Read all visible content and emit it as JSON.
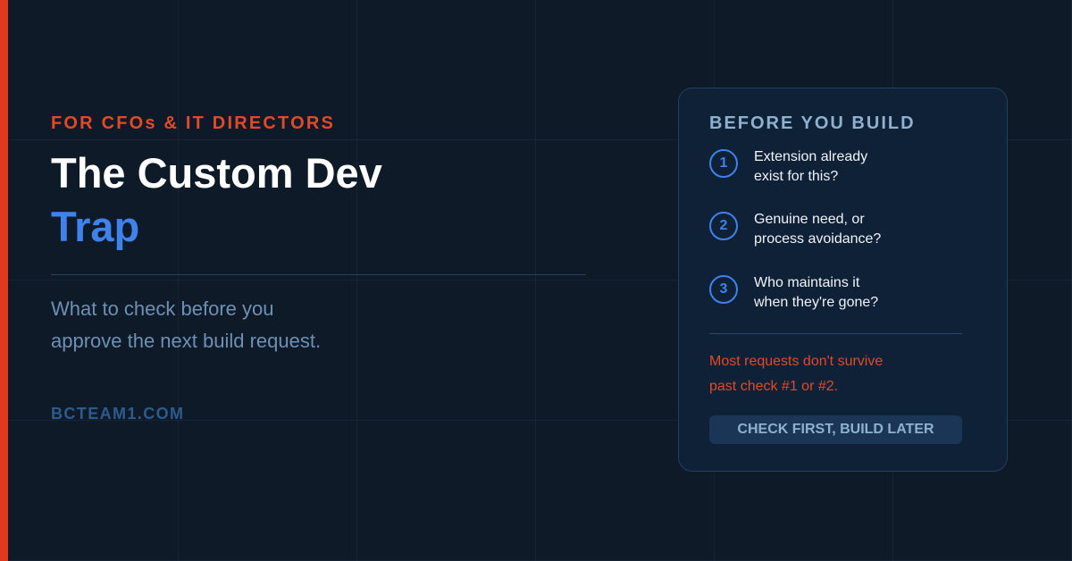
{
  "hero": {
    "eyebrow": "FOR CFOs & IT DIRECTORS",
    "title_line1": "The Custom Dev",
    "title_line2": "Trap",
    "subtitle_line1": "What to check before you",
    "subtitle_line2": "approve the next build request.",
    "site": "BCTEAM1.COM"
  },
  "card": {
    "title": "BEFORE YOU BUILD",
    "steps": [
      {
        "number": "1",
        "line1": "Extension already",
        "line2": "exist for this?"
      },
      {
        "number": "2",
        "line1": "Genuine need, or",
        "line2": "process avoidance?"
      },
      {
        "number": "3",
        "line1": "Who maintains it",
        "line2": "when they're gone?"
      }
    ],
    "warning_line1": "Most requests don't survive",
    "warning_line2": "past check #1 or #2.",
    "cta_label": "CHECK FIRST, BUILD LATER"
  },
  "colors": {
    "accent_red": "#e03a1e",
    "accent_blue": "#3f82ec",
    "background": "#0f1a28",
    "card_background": "#0f2136"
  }
}
